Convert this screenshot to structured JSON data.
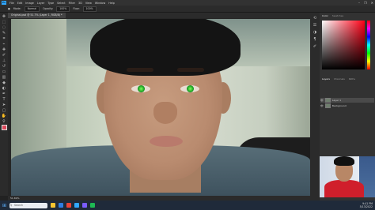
{
  "menubar": {
    "logo": "Ps",
    "items": [
      "File",
      "Edit",
      "Image",
      "Layer",
      "Type",
      "Select",
      "Filter",
      "3D",
      "View",
      "Window",
      "Help"
    ]
  },
  "window_controls": [
    "–",
    "❐",
    "✕"
  ],
  "options_bar": {
    "mode_label": "Mode:",
    "mode_value": "Normal",
    "opacity_label": "Opacity:",
    "opacity_value": "100%",
    "flow_label": "Flow:",
    "flow_value": "100%"
  },
  "document_tab": {
    "title": "Original.psd @ 51.7% (Layer 1, RGB/8) *"
  },
  "status_bar": {
    "zoom": "51.69%"
  },
  "panels": {
    "color_tabs": [
      "Color",
      "Swatches"
    ],
    "layer_tabs": [
      "Layers",
      "Channels",
      "Paths"
    ],
    "layers": [
      {
        "name": "Layer 1"
      },
      {
        "name": "Background"
      }
    ]
  },
  "colors": {
    "accent": "#31a8ff",
    "foreground": "#d9485a",
    "iris": "#3ec93a"
  },
  "taskbar": {
    "search_placeholder": "Search",
    "time": "9:41 PM",
    "date": "5/13/2022"
  }
}
